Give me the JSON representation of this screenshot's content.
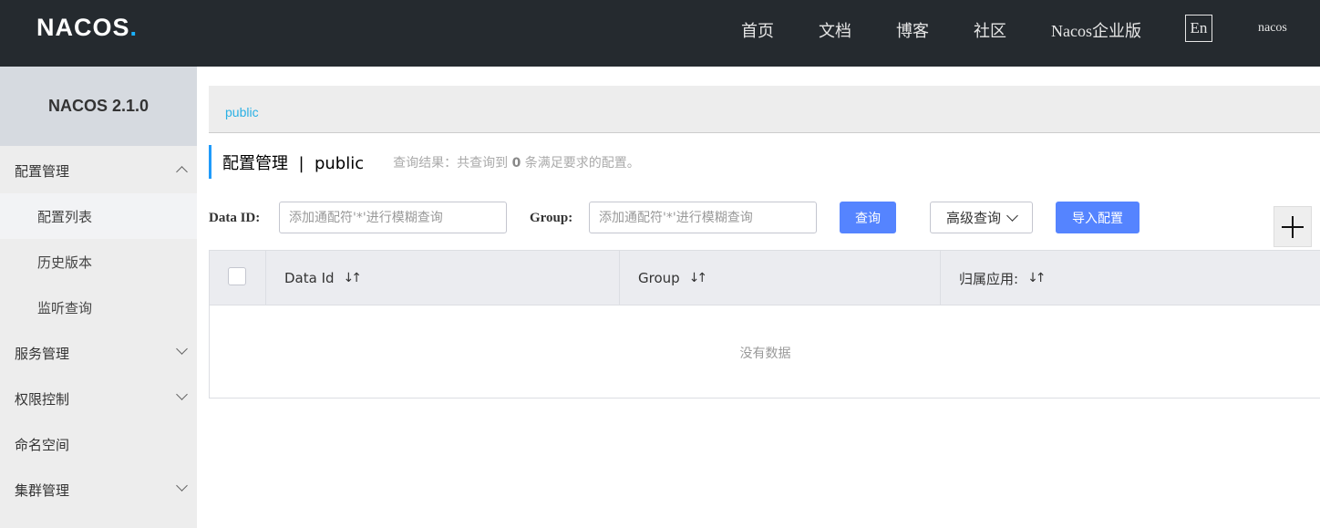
{
  "app": {
    "logo_text": "NACOS",
    "logo_dot": ".",
    "nav": [
      "首页",
      "文档",
      "博客",
      "社区",
      "Nacos企业版"
    ],
    "lang_toggle": "En",
    "user": "nacos"
  },
  "sidebar": {
    "title": "NACOS 2.1.0",
    "items": [
      {
        "label": "配置管理",
        "type": "top",
        "expanded": true
      },
      {
        "label": "配置列表",
        "type": "sub",
        "active": true
      },
      {
        "label": "历史版本",
        "type": "sub"
      },
      {
        "label": "监听查询",
        "type": "sub"
      },
      {
        "label": "服务管理",
        "type": "top",
        "expanded": false
      },
      {
        "label": "权限控制",
        "type": "top",
        "expanded": false
      },
      {
        "label": "命名空间",
        "type": "top"
      },
      {
        "label": "集群管理",
        "type": "top",
        "expanded": false
      }
    ]
  },
  "breadcrumb": "public",
  "page": {
    "title": "配置管理  |  public",
    "query_prefix": "查询结果：共查询到",
    "query_count": "0",
    "query_suffix": "条满足要求的配置。"
  },
  "filters": {
    "data_id_label": "Data ID:",
    "data_id_placeholder": "添加通配符'*'进行模糊查询",
    "data_id_value": "",
    "group_label": "Group:",
    "group_placeholder": "添加通配符'*'进行模糊查询",
    "group_value": "",
    "search_button": "查询",
    "advanced_button": "高级查询",
    "import_button": "导入配置"
  },
  "table": {
    "columns": [
      "Data Id",
      "Group",
      "归属应用:"
    ],
    "sort_icon": "↓↑",
    "empty_text": "没有数据"
  },
  "colors": {
    "topbar": "#252a2f",
    "primary": "#5584ff",
    "accent": "#209bfa",
    "breadcrumb_link": "#2ab0e4"
  }
}
